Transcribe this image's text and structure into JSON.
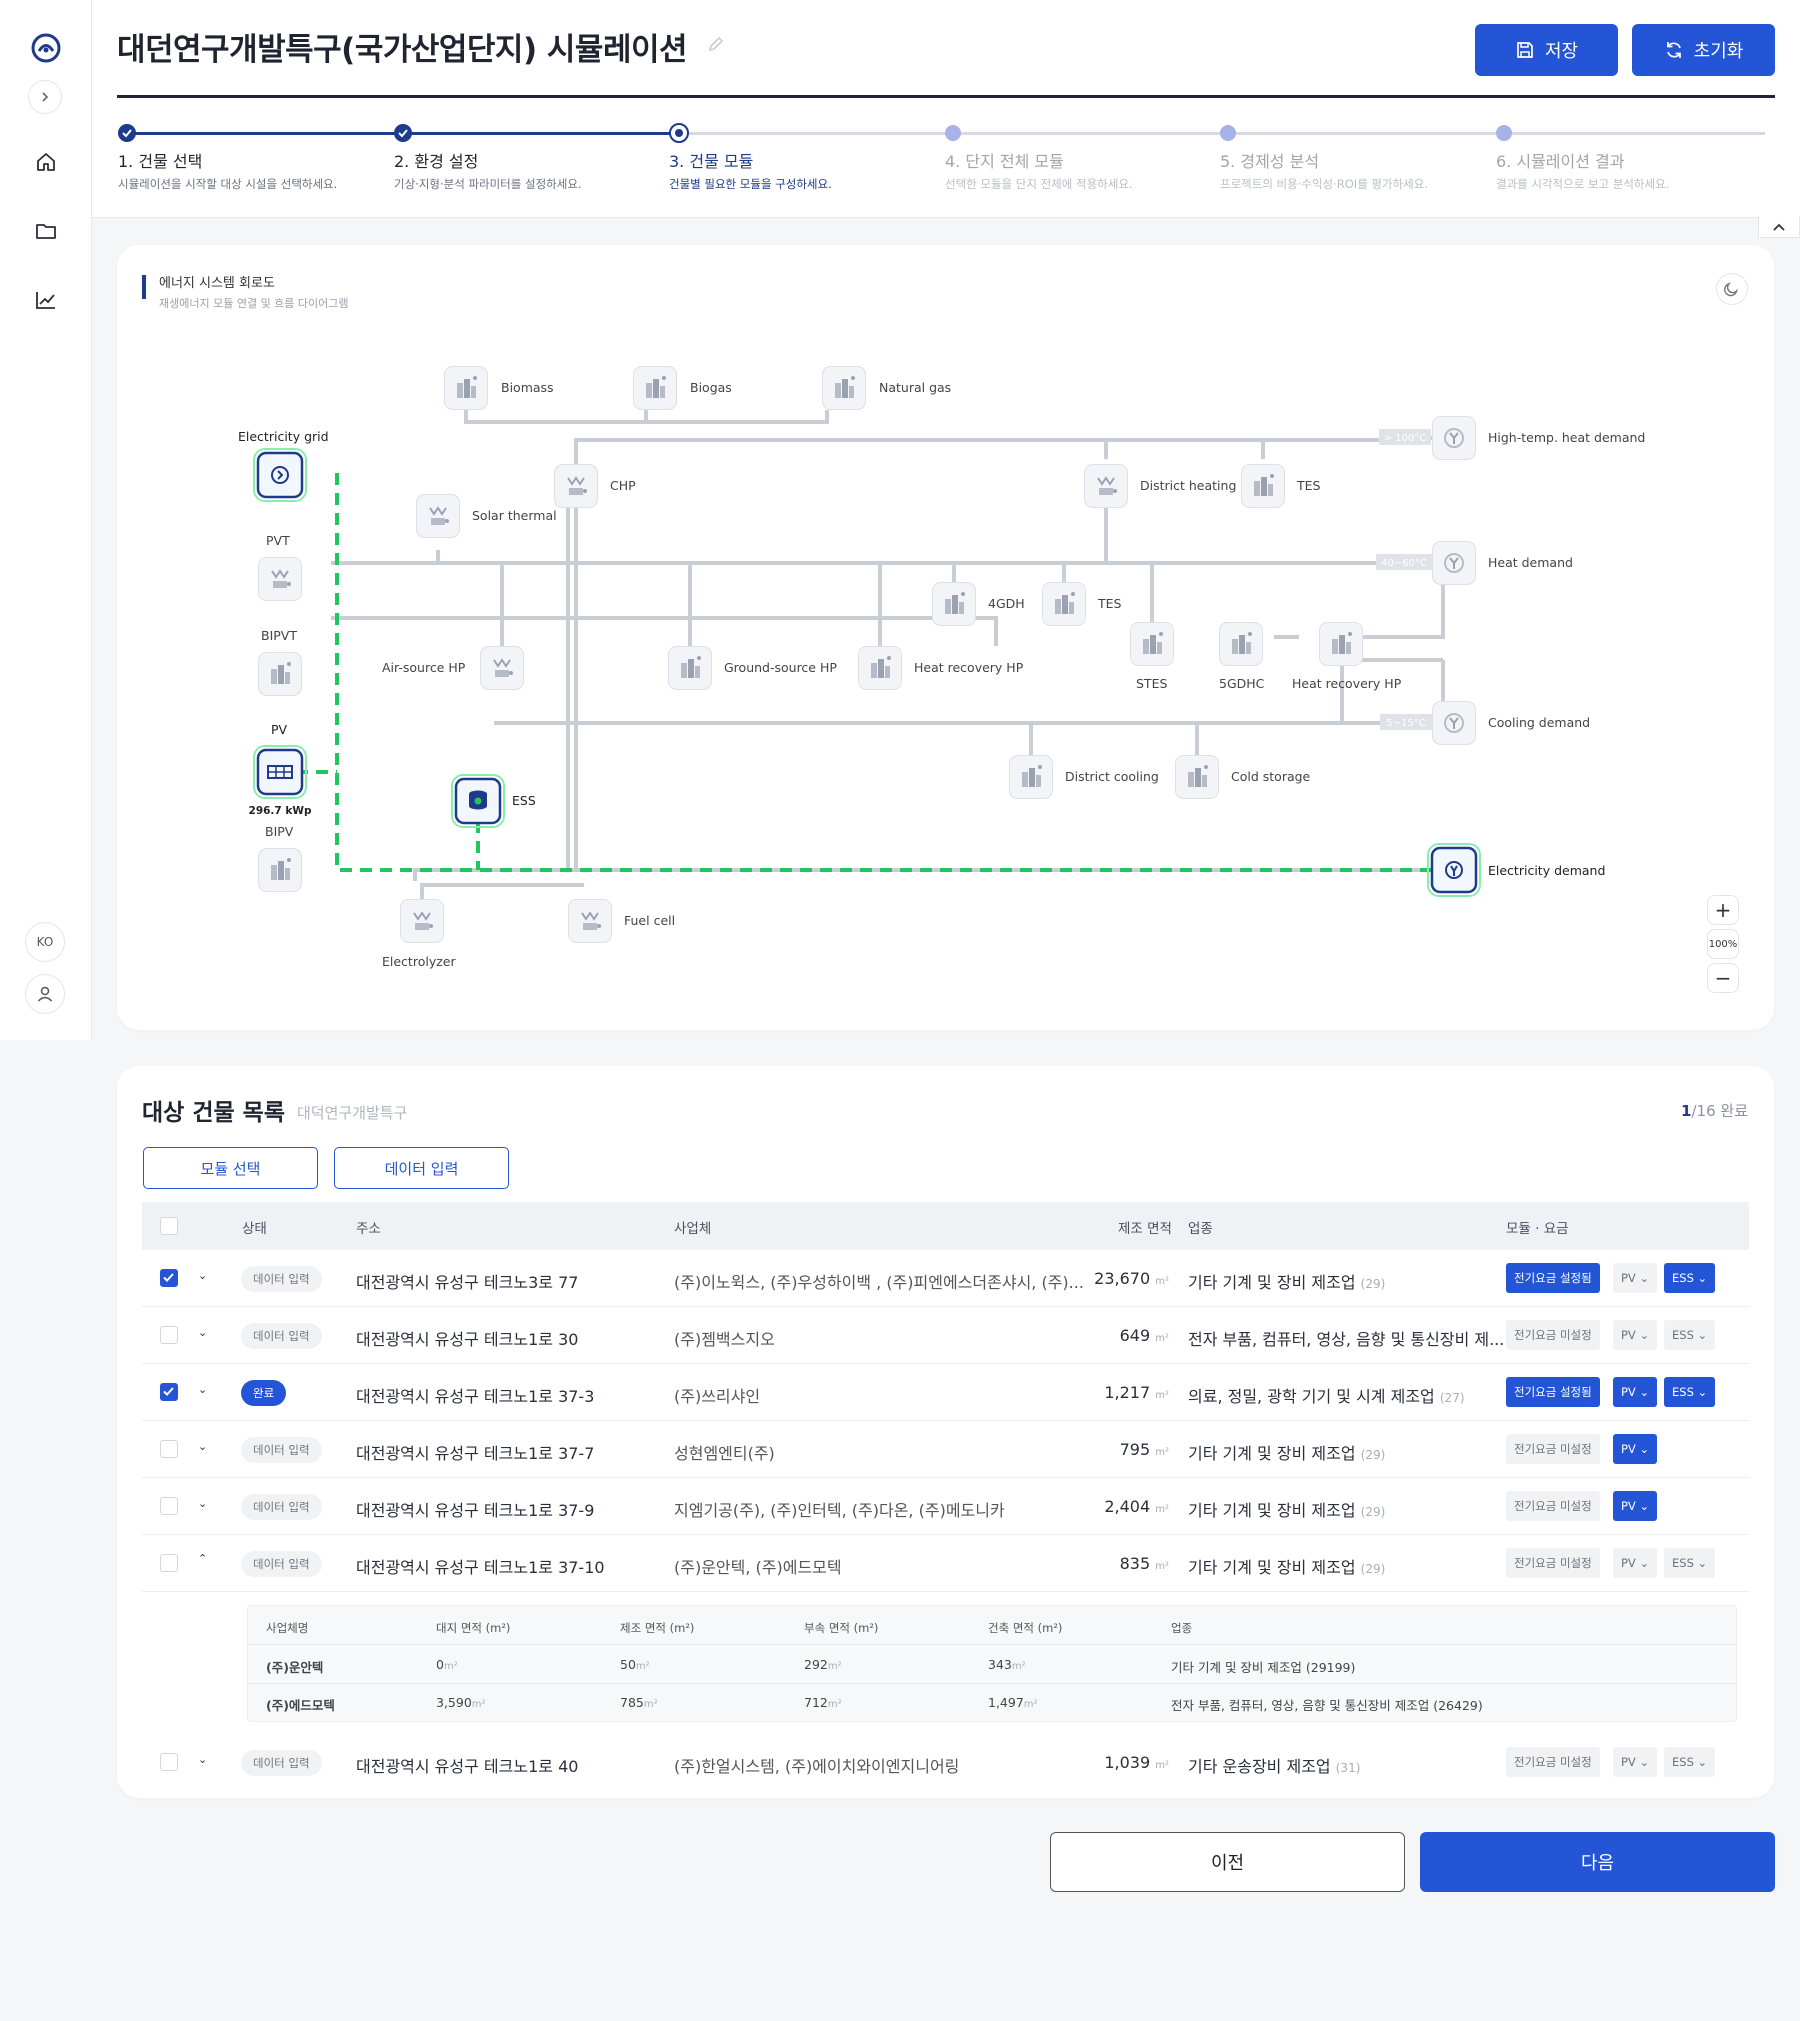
{
  "sidebar": {
    "lang": "KO"
  },
  "header": {
    "title": "대던연구개발특구(국가산업단지) 시뮬레이션",
    "save_label": "저장",
    "reset_label": "초기화"
  },
  "steps": [
    {
      "label": "1. 건물 선택",
      "desc": "시뮬레이션을 시작할 대상 시설을 선택하세요."
    },
    {
      "label": "2. 환경 설정",
      "desc": "기상·지형·분석 파라미터를 설정하세요."
    },
    {
      "label": "3. 건물 모듈",
      "desc": "건물별 필요한 모듈을 구성하세요."
    },
    {
      "label": "4. 단지 전체 모듈",
      "desc": "선택한 모듈을 단지 전체에 적용하세요."
    },
    {
      "label": "5. 경제성 분석",
      "desc": "프로젝트의 비용·수익성·ROI를 평가하세요."
    },
    {
      "label": "6. 시뮬레이션 결과",
      "desc": "결과를 시각적으로 보고 분석하세요."
    }
  ],
  "diagram": {
    "title": "에너지 시스템 회로도",
    "subtitle": "재생에너지 모듈 연결 및 흐름 다이어그램",
    "zoom": "100%",
    "pv_capacity": "296.7 kWp",
    "temp_labels": {
      "high": "> 100°C",
      "mid": "40~60°C",
      "low": "5~15°C"
    },
    "nodes": {
      "biomass": "Biomass",
      "biogas": "Biogas",
      "natural_gas": "Natural gas",
      "electricity_grid": "Electricity grid",
      "chp": "CHP",
      "solar_thermal": "Solar thermal",
      "pvt": "PVT",
      "bipvt": "BIPVT",
      "pv": "PV",
      "bipv": "BIPV",
      "ess": "ESS",
      "district_heating": "District heating",
      "tes_top": "TES",
      "high_temp_demand": "High-temp. heat demand",
      "heat_demand": "Heat demand",
      "gdh4": "4GDH",
      "tes_mid": "TES",
      "stes": "STES",
      "gdhc5": "5GDHC",
      "hrhp_right": "Heat recovery HP",
      "air_hp": "Air-source HP",
      "ground_hp": "Ground-source HP",
      "hrhp_mid": "Heat recovery HP",
      "cooling_demand": "Cooling demand",
      "district_cooling": "District cooling",
      "cold_storage": "Cold storage",
      "electricity_demand": "Electricity demand",
      "electrolyzer": "Electrolyzer",
      "fuel_cell": "Fuel cell"
    }
  },
  "list": {
    "title": "대상 건물 목록",
    "subtitle": "대덕연구개발특구",
    "progress_done": "1",
    "progress_total": "/16 완료",
    "module_btn": "모듈 선택",
    "data_btn": "데이터 입력",
    "headers": {
      "status": "상태",
      "address": "주소",
      "company": "사업체",
      "area": "제조 면적",
      "industry": "업종",
      "module": "모듈 · 요금"
    },
    "unit": "m²",
    "rows": [
      {
        "status": "데이터 입력",
        "address": "대전광역시 유성구 테크노3로 77",
        "company": "(주)이노윅스, (주)우성하이백 , (주)피엔에스더존샤시, (주)...",
        "area": "23,670",
        "industry": "기타 기계 및 장비 제조업",
        "code": "(29)",
        "tariff": "전기요금 설정됨",
        "pv": "PV",
        "ess": "ESS"
      },
      {
        "status": "데이터 입력",
        "address": "대전광역시 유성구 테크노1로 30",
        "company": "(주)젬백스지오",
        "area": "649",
        "industry": "전자 부품, 컴퓨터, 영상, 음향 및 통신장비 제...",
        "code": "",
        "tariff": "전기요금 미설정",
        "pv": "PV",
        "ess": "ESS"
      },
      {
        "status": "완료",
        "address": "대전광역시 유성구 테크노1로 37-3",
        "company": "(주)쓰리샤인",
        "area": "1,217",
        "industry": "의료, 정밀, 광학 기기 및 시계 제조업",
        "code": "(27)",
        "tariff": "전기요금 설정됨",
        "pv": "PV",
        "ess": "ESS"
      },
      {
        "status": "데이터 입력",
        "address": "대전광역시 유성구 테크노1로 37-7",
        "company": "성현엠엔티(주)",
        "area": "795",
        "industry": "기타 기계 및 장비 제조업",
        "code": "(29)",
        "tariff": "전기요금 미설정",
        "pv": "PV",
        "ess": ""
      },
      {
        "status": "데이터 입력",
        "address": "대전광역시 유성구 테크노1로 37-9",
        "company": "지엠기공(주), (주)인터텍, (주)다온, (주)메도니카",
        "area": "2,404",
        "industry": "기타 기계 및 장비 제조업",
        "code": "(29)",
        "tariff": "전기요금 미설정",
        "pv": "PV",
        "ess": ""
      },
      {
        "status": "데이터 입력",
        "address": "대전광역시 유성구 테크노1로 37-10",
        "company": "(주)운안텍, (주)에드모텍",
        "area": "835",
        "industry": "기타 기계 및 장비 제조업",
        "code": "(29)",
        "tariff": "전기요금 미설정",
        "pv": "PV",
        "ess": "ESS"
      },
      {
        "status": "데이터 입력",
        "address": "대전광역시 유성구 테크노1로 40",
        "company": "(주)한얼시스템, (주)에이치와이엔지니어링",
        "area": "1,039",
        "industry": "기타 운송장비 제조업",
        "code": "(31)",
        "tariff": "전기요금 미설정",
        "pv": "PV",
        "ess": "ESS"
      }
    ],
    "detail": {
      "headers": [
        "사업체명",
        "대지 면적 (m²)",
        "제조 면적 (m²)",
        "부속 면적 (m²)",
        "건축 면적 (m²)",
        "업종"
      ],
      "rows": [
        {
          "name": "(주)운안텍",
          "land": "0",
          "mfg": "50",
          "aux": "292",
          "bldg": "343",
          "industry": "기타 기계 및 장비 제조업 (29199)"
        },
        {
          "name": "(주)에드모텍",
          "land": "3,590",
          "mfg": "785",
          "aux": "712",
          "bldg": "1,497",
          "industry": "전자 부품, 컴퓨터, 영상, 음향 및 통신장비 제조업 (26429)"
        }
      ]
    }
  },
  "footer": {
    "prev": "이전",
    "next": "다음"
  }
}
